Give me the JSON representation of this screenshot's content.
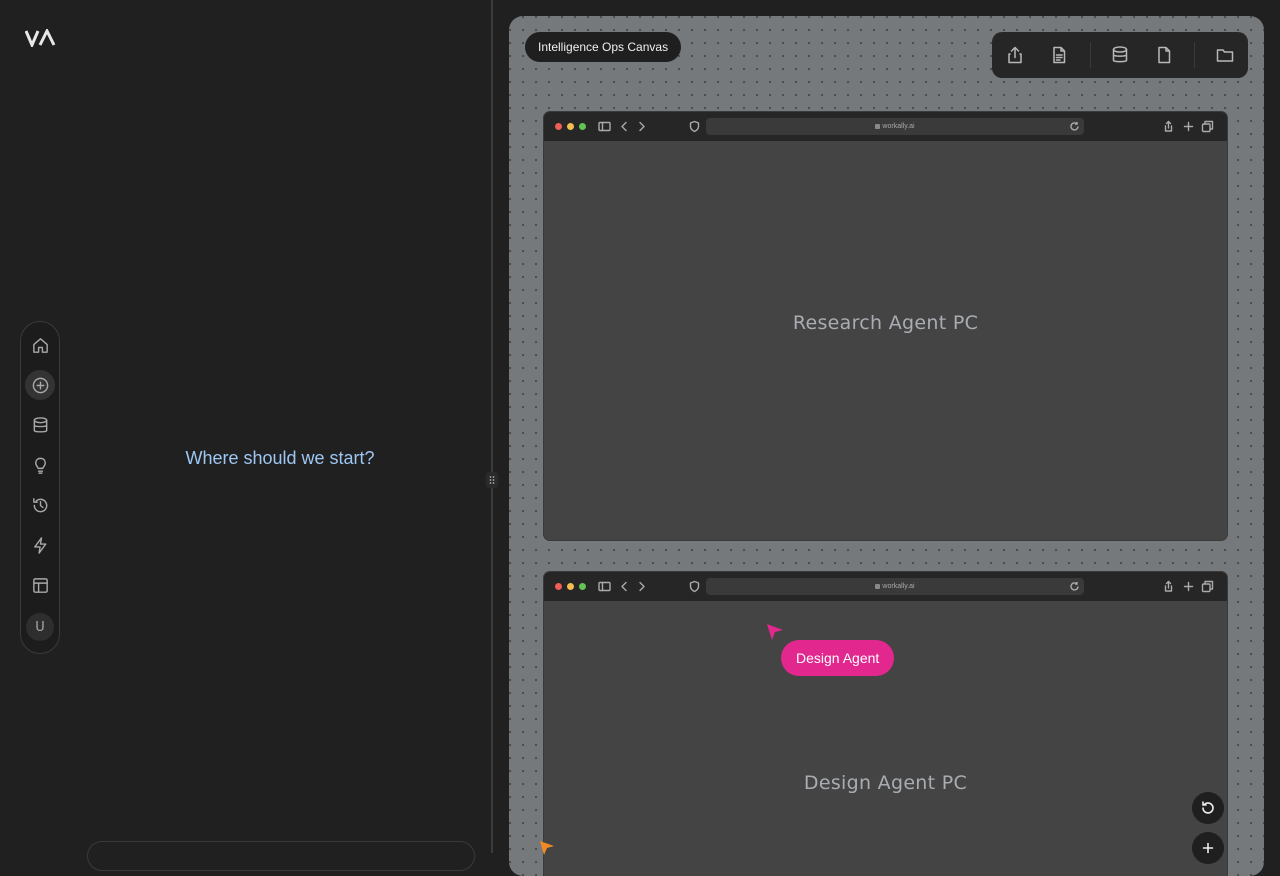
{
  "brand": {
    "logo_text": "VA"
  },
  "sidebar": {
    "items": [
      {
        "name": "home",
        "icon": "home-icon"
      },
      {
        "name": "new",
        "icon": "plus-circle-icon",
        "active": true
      },
      {
        "name": "data",
        "icon": "database-icon"
      },
      {
        "name": "ideas",
        "icon": "lightbulb-icon"
      },
      {
        "name": "history",
        "icon": "history-icon"
      },
      {
        "name": "automations",
        "icon": "lightning-icon"
      },
      {
        "name": "layout",
        "icon": "layout-icon"
      }
    ],
    "avatar_initial": "U"
  },
  "main": {
    "prompt": "Where should we start?"
  },
  "canvas": {
    "title": "Intelligence Ops Canvas",
    "toolbar": [
      "share-icon",
      "document-icon",
      "database-icon",
      "file-icon",
      "folder-icon"
    ],
    "windows": [
      {
        "url": "workally.ai",
        "label": "Research Agent PC"
      },
      {
        "url": "workally.ai",
        "label": "Design Agent PC"
      }
    ],
    "agent_tag": {
      "label": "Design Agent",
      "color": "#e2288e"
    },
    "colors": {
      "canvas_bg": "#75797b",
      "traffic_red": "#ed5f57",
      "traffic_yellow": "#f4bd4f",
      "traffic_green": "#61c554",
      "prompt": "#9ec6f2"
    }
  }
}
